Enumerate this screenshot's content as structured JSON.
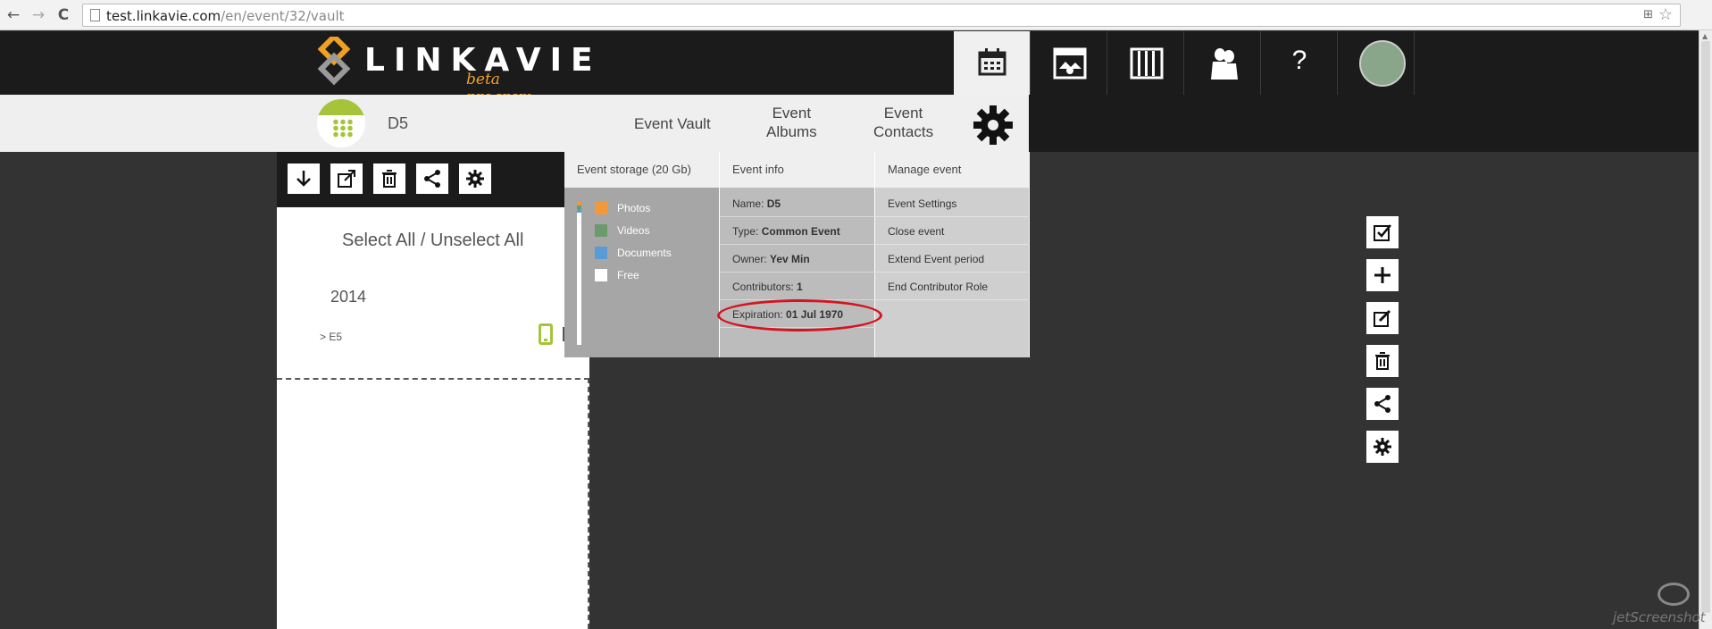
{
  "browser": {
    "url_host": "test.linkavie.com",
    "url_path": "/en/event/32/vault",
    "back_glyph": "←",
    "forward_glyph": "→",
    "reload_glyph": "C"
  },
  "header": {
    "logo_text": "LINKAVIE",
    "logo_sub": "beta program",
    "icons": [
      "calendar-icon",
      "vault-icon",
      "albums-icon",
      "contacts-icon",
      "help-icon",
      "user-avatar"
    ],
    "help_label": "?"
  },
  "event": {
    "name": "D5",
    "nav": {
      "vault": "Event Vault",
      "albums_line1": "Event",
      "albums_line2": "Albums",
      "contacts_line1": "Event",
      "contacts_line2": "Contacts"
    }
  },
  "left_panel": {
    "select_all": "Select All / Unselect All",
    "year": "2014",
    "item": "> E5"
  },
  "dropdown": {
    "storage": {
      "header": "Event storage (20 Gb)",
      "legend": [
        {
          "label": "Photos",
          "color": "#f29a3b"
        },
        {
          "label": "Videos",
          "color": "#6d9a6d"
        },
        {
          "label": "Documents",
          "color": "#5b9bd5"
        },
        {
          "label": "Free",
          "color": "#ffffff"
        }
      ]
    },
    "info": {
      "header": "Event info",
      "name_label": "Name:",
      "name_value": "D5",
      "type_label": "Type:",
      "type_value": "Common Event",
      "owner_label": "Owner:",
      "owner_value": "Yev Min",
      "contributors_label": "Contributors:",
      "contributors_value": "1",
      "expiration_label": "Expiration:",
      "expiration_value": "01 Jul 1970"
    },
    "manage": {
      "header": "Manage event",
      "items": [
        "Event Settings",
        "Close event",
        "Extend Event period",
        "End Contributor Role"
      ]
    }
  },
  "colors": {
    "brand_orange": "#f1a122",
    "brand_green": "#a6c43a",
    "highlight_red": "#d4141f"
  },
  "watermark": "jetScreenshot"
}
